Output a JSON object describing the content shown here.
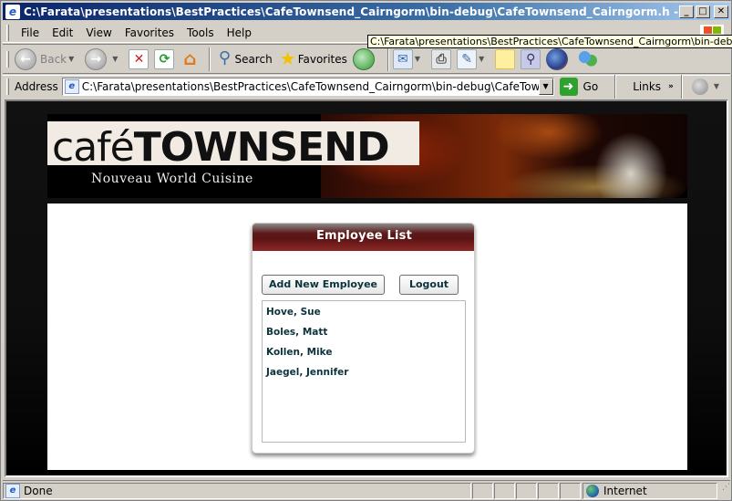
{
  "window": {
    "title": "C:\\Farata\\presentations\\BestPractices\\CafeTownsend_Cairngorm\\bin-debug\\CafeTownsend_Cairngorm.h - Microsoft Interne...",
    "buttons": {
      "minimize": "_",
      "maximize": "□",
      "close": "✕"
    }
  },
  "menubar": {
    "items": [
      {
        "label": "File",
        "accel": "F"
      },
      {
        "label": "Edit",
        "accel": "E"
      },
      {
        "label": "View",
        "accel": "V"
      },
      {
        "label": "Favorites",
        "accel": "a"
      },
      {
        "label": "Tools",
        "accel": "T"
      },
      {
        "label": "Help",
        "accel": "H"
      }
    ]
  },
  "tooltip": {
    "text": "C:\\Farata\\presentations\\BestPractices\\CafeTownsend_Cairngorm\\bin-debug\\CafeTownsend_Cairngorm.html"
  },
  "toolbar": {
    "back_label": "Back",
    "search_label": "Search",
    "favorites_label": "Favorites",
    "icons": [
      "back-icon",
      "forward-icon",
      "stop-icon",
      "refresh-icon",
      "home-icon",
      "search-icon",
      "favorites-icon",
      "history-icon",
      "mail-icon",
      "print-icon",
      "edit-icon",
      "notes-icon",
      "research-icon",
      "firefox-icon",
      "messenger-icon"
    ]
  },
  "addressbar": {
    "label": "Address",
    "value": "C:\\Farata\\presentations\\BestPractices\\CafeTownsend_Cairngorm\\bin-debug\\CafeTownsend_Cairngorm.html",
    "go_label": "Go",
    "links_label": "Links",
    "links_chevron": "»"
  },
  "banner": {
    "logo_cafe": "café",
    "logo_townsend": "TOWNSEND",
    "tagline": "Nouveau World Cuisine"
  },
  "panel": {
    "title": "Employee List",
    "add_button": "Add New Employee",
    "logout_button": "Logout",
    "employees": [
      "Hove, Sue",
      "Boles, Matt",
      "Kollen, Mike",
      "Jaegel, Jennifer"
    ]
  },
  "statusbar": {
    "status": "Done",
    "zone": "Internet"
  }
}
